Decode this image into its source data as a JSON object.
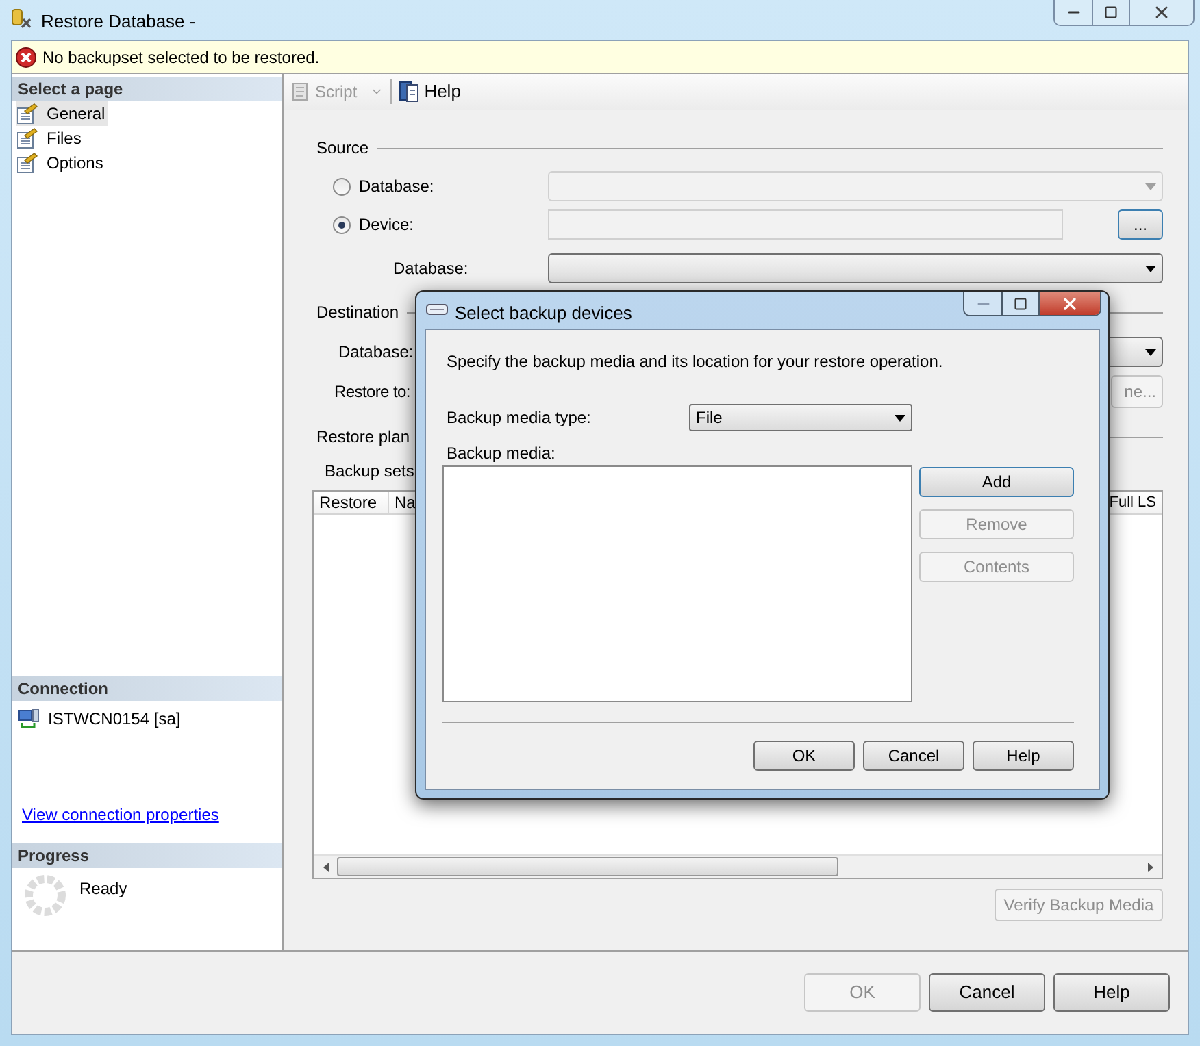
{
  "window": {
    "title": "Restore Database -"
  },
  "error_bar": {
    "message": "No backupset selected to be restored."
  },
  "sidebar": {
    "header": "Select a page",
    "pages": [
      {
        "label": "General",
        "selected": true
      },
      {
        "label": "Files",
        "selected": false
      },
      {
        "label": "Options",
        "selected": false
      }
    ],
    "connection": {
      "header": "Connection",
      "server": "ISTWCN0154 [sa]",
      "link": "View connection properties"
    },
    "progress": {
      "header": "Progress",
      "status": "Ready"
    }
  },
  "toolbar": {
    "script": {
      "label": "Script",
      "disabled": true
    },
    "help": {
      "label": "Help",
      "disabled": false
    }
  },
  "source": {
    "title": "Source",
    "options": [
      {
        "label": "Database:",
        "selected": false
      },
      {
        "label": "Device:",
        "selected": true
      }
    ],
    "browse_button": "...",
    "database_label": "Database:"
  },
  "destination": {
    "title": "Destination",
    "database_label": "Database:",
    "restore_to_label": "Restore to:",
    "timeline_button": "ne..."
  },
  "restore_plan": {
    "title": "Restore plan",
    "backup_sets_label": "Backup sets",
    "columns": [
      "Restore",
      "Na",
      "Full LS"
    ]
  },
  "verify_button": {
    "label": "Verify Backup Media",
    "disabled": true
  },
  "footer_buttons": [
    {
      "label": "OK",
      "disabled": true
    },
    {
      "label": "Cancel",
      "disabled": false
    },
    {
      "label": "Help",
      "disabled": false
    }
  ],
  "dialog": {
    "title": "Select backup devices",
    "instruction": "Specify the backup media and its location for your restore operation.",
    "media_type_label": "Backup media type:",
    "media_type": "File",
    "media_label": "Backup media:",
    "side_buttons": [
      {
        "label": "Add",
        "disabled": false,
        "focused": true
      },
      {
        "label": "Remove",
        "disabled": true,
        "focused": false
      },
      {
        "label": "Contents",
        "disabled": true,
        "focused": false
      }
    ],
    "buttons": [
      {
        "label": "OK",
        "disabled": false
      },
      {
        "label": "Cancel",
        "disabled": false
      },
      {
        "label": "Help",
        "disabled": false
      }
    ]
  }
}
